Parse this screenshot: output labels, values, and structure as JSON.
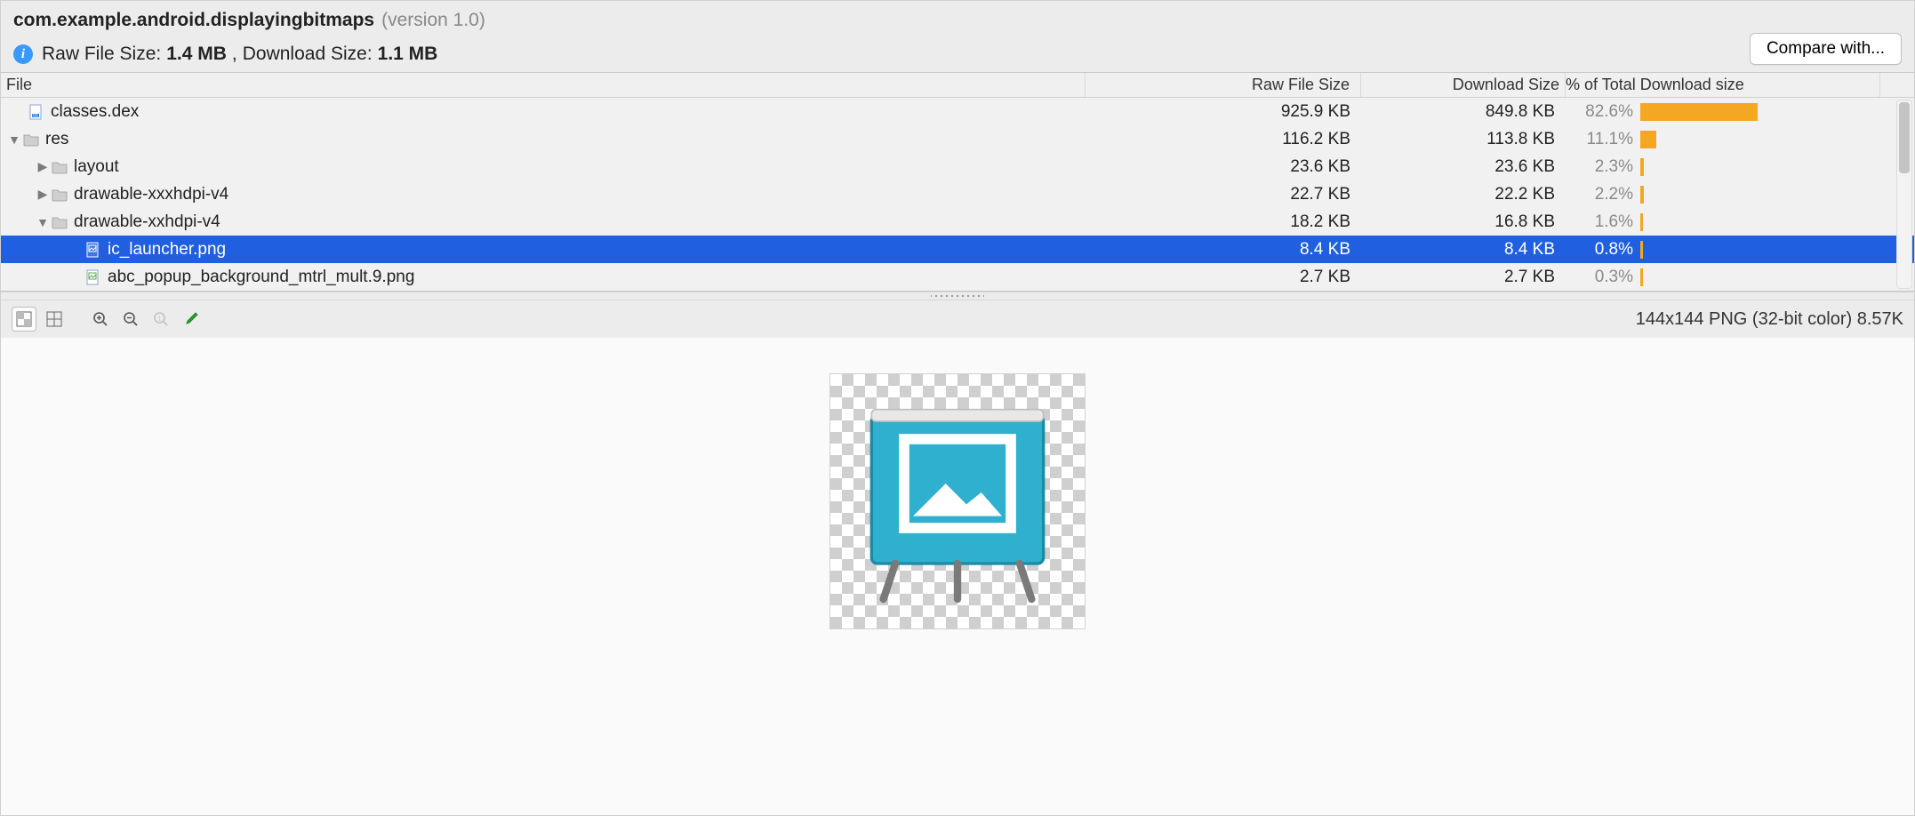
{
  "header": {
    "package": "com.example.android.displayingbitmaps",
    "version_label": "(version 1.0)",
    "raw_label": "Raw File Size:",
    "raw_value": "1.4 MB",
    "separator": ",",
    "dl_label": "Download Size:",
    "dl_value": "1.1 MB",
    "compare_button": "Compare with..."
  },
  "columns": {
    "file": "File",
    "raw": "Raw File Size",
    "dl": "Download Size",
    "pct": "% of Total Download size"
  },
  "rows": [
    {
      "depth": 0,
      "arrow": "none",
      "icon": "dex",
      "name": "classes.dex",
      "raw": "925.9 KB",
      "dl": "849.8 KB",
      "pct": "82.6%",
      "bar": 0.826,
      "selected": false
    },
    {
      "depth": 0,
      "arrow": "down",
      "icon": "folder",
      "name": "res",
      "raw": "116.2 KB",
      "dl": "113.8 KB",
      "pct": "11.1%",
      "bar": 0.111,
      "selected": false
    },
    {
      "depth": 1,
      "arrow": "right",
      "icon": "folder",
      "name": "layout",
      "raw": "23.6 KB",
      "dl": "23.6 KB",
      "pct": "2.3%",
      "bar": 0.023,
      "selected": false
    },
    {
      "depth": 1,
      "arrow": "right",
      "icon": "folder",
      "name": "drawable-xxxhdpi-v4",
      "raw": "22.7 KB",
      "dl": "22.2 KB",
      "pct": "2.2%",
      "bar": 0.022,
      "selected": false
    },
    {
      "depth": 1,
      "arrow": "down",
      "icon": "folder",
      "name": "drawable-xxhdpi-v4",
      "raw": "18.2 KB",
      "dl": "16.8 KB",
      "pct": "1.6%",
      "bar": 0.016,
      "selected": false
    },
    {
      "depth": 2,
      "arrow": "none",
      "icon": "image",
      "name": "ic_launcher.png",
      "raw": "8.4 KB",
      "dl": "8.4 KB",
      "pct": "0.8%",
      "bar": 0.008,
      "selected": true
    },
    {
      "depth": 2,
      "arrow": "none",
      "icon": "image",
      "name": "abc_popup_background_mtrl_mult.9.png",
      "raw": "2.7 KB",
      "dl": "2.7 KB",
      "pct": "0.3%",
      "bar": 0.003,
      "selected": false
    }
  ],
  "preview": {
    "info": "144x144 PNG (32-bit color) 8.57K"
  },
  "icons": {
    "info": "i"
  }
}
